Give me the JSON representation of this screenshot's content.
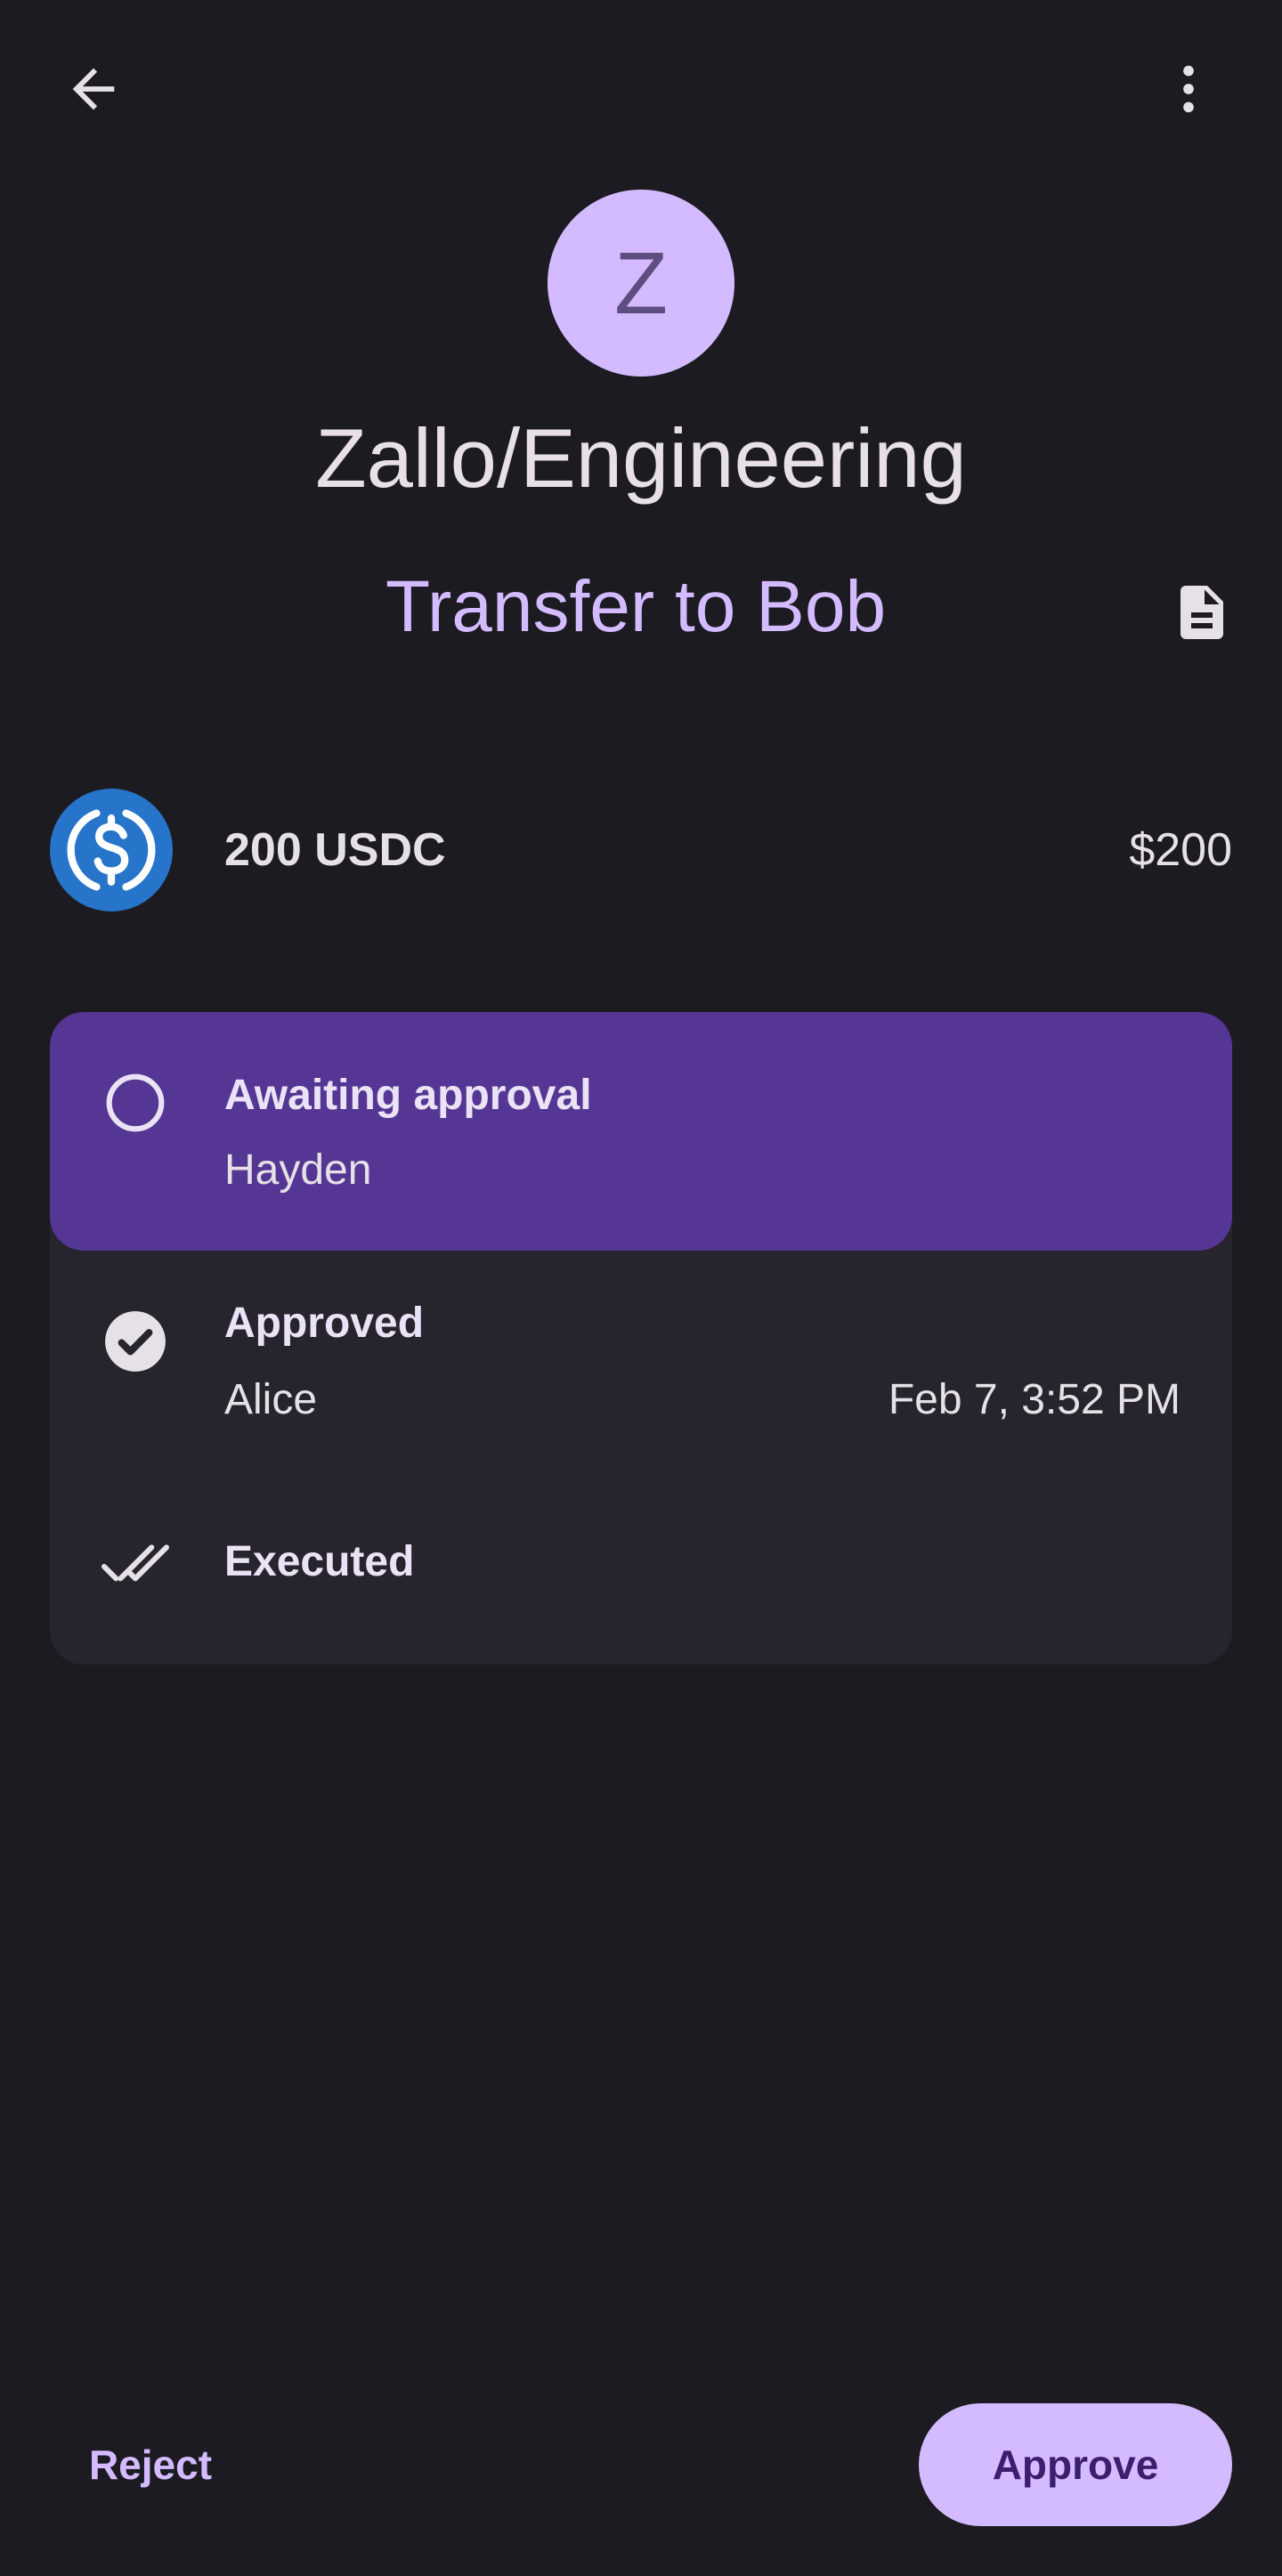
{
  "header": {
    "back_icon": "arrow-back-icon",
    "more_icon": "more-vertical-icon"
  },
  "account": {
    "avatar_letter": "Z",
    "name": "Zallo/Engineering"
  },
  "transaction": {
    "label": "Transfer to Bob",
    "doc_icon": "document-icon"
  },
  "transfer": {
    "token_icon": "usdc-icon",
    "amount": "200 USDC",
    "value": "$200"
  },
  "steps": {
    "awaiting": {
      "title": "Awaiting approval",
      "subtitle": "Hayden",
      "icon": "circle-outline-icon"
    },
    "approved": {
      "title": "Approved",
      "subtitle": "Alice",
      "time": "Feb 7, 3:52 PM",
      "icon": "check-circle-icon"
    },
    "executed": {
      "title": "Executed",
      "icon": "double-check-icon"
    }
  },
  "actions": {
    "reject_label": "Reject",
    "approve_label": "Approve"
  },
  "colors": {
    "background": "#1c1b21",
    "primary": "#d4bbff",
    "highlight": "#553694",
    "card": "#26252e",
    "usdc": "#2775ca"
  }
}
